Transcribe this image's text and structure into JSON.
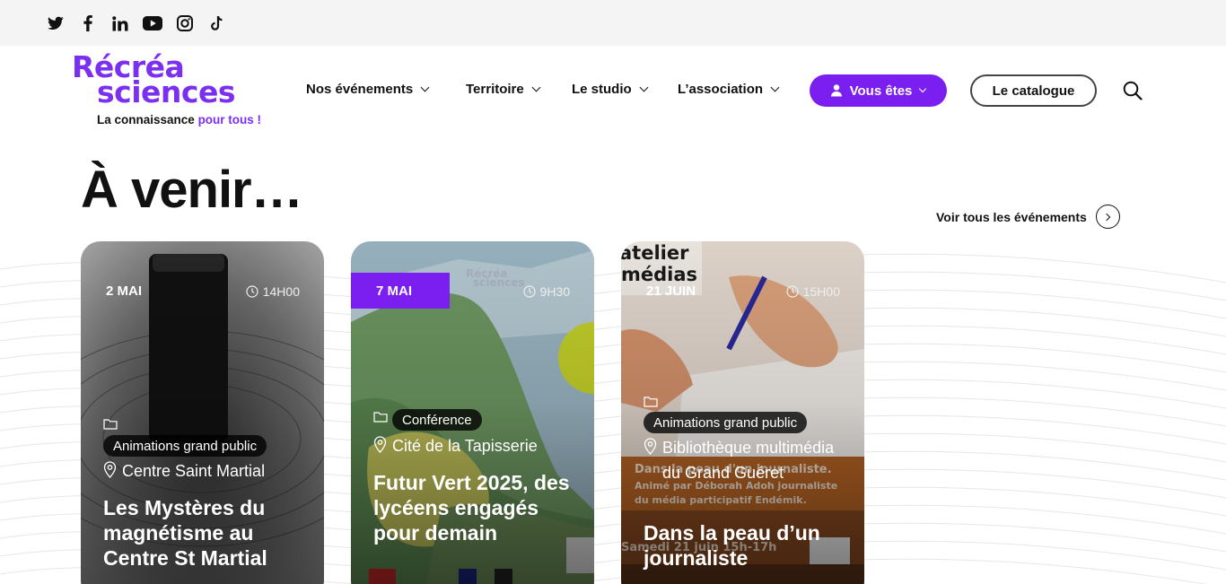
{
  "social": {
    "icons": [
      "twitter-icon",
      "facebook-icon",
      "linkedin-icon",
      "youtube-icon",
      "instagram-icon",
      "tiktok-icon"
    ]
  },
  "logo": {
    "line1": "Récréa",
    "line2": "sciences",
    "tagline_main": "La connaissance ",
    "tagline_accent": "pour tous !"
  },
  "nav": {
    "items": [
      {
        "label": "Nos événements"
      },
      {
        "label": "Territoire"
      },
      {
        "label": "Le studio"
      },
      {
        "label": "L’association"
      }
    ],
    "vous_etes": "Vous êtes",
    "catalogue": "Le catalogue"
  },
  "section": {
    "heading": "À venir…",
    "see_all": "Voir tous les événements"
  },
  "events": [
    {
      "date": "2 MAI",
      "time": "14H00",
      "category": "Animations grand public",
      "location": "Centre Saint Martial",
      "title": "Les Mystères du magnétisme au Centre St Martial"
    },
    {
      "date": "7 MAI",
      "time": "9H30",
      "category": "Conférence",
      "location": "Cité de la Tapisserie",
      "title": "Futur Vert 2025, des lycéens engagés pour demain"
    },
    {
      "date": "21 JUIN",
      "time": "15H00",
      "category": "Animations grand public",
      "location": "Bibliothèque multimédia du Grand Guéret",
      "title": "Dans la peau d’un journaliste"
    }
  ],
  "colors": {
    "brand_purple": "#7b1ff0",
    "topbar_bg": "#f4f4f4"
  }
}
